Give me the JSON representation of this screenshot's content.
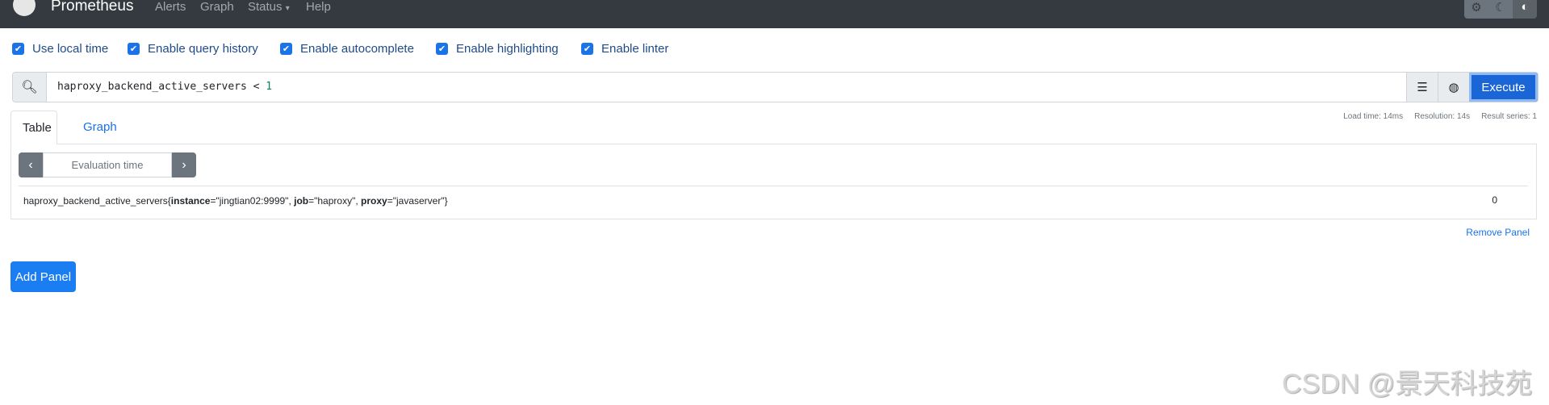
{
  "navbar": {
    "brand": "Prometheus",
    "links": [
      "Alerts",
      "Graph",
      "Status",
      "Help"
    ],
    "status_caret": "▾",
    "theme_icons": [
      "gear-icon",
      "moon-icon",
      "contrast-icon"
    ]
  },
  "options": [
    {
      "label": "Use local time",
      "checked": true
    },
    {
      "label": "Enable query history",
      "checked": true
    },
    {
      "label": "Enable autocomplete",
      "checked": true
    },
    {
      "label": "Enable highlighting",
      "checked": true
    },
    {
      "label": "Enable linter",
      "checked": true
    }
  ],
  "query": {
    "metric": "haproxy_backend_active_servers",
    "operator": "<",
    "value": "1",
    "execute_label": "Execute"
  },
  "stats": {
    "load_time": "Load time: 14ms",
    "resolution": "Resolution: 14s",
    "result_series": "Result series: 1"
  },
  "tabs": {
    "table": "Table",
    "graph": "Graph"
  },
  "eval": {
    "placeholder": "Evaluation time"
  },
  "result": {
    "metric": "haproxy_backend_active_servers",
    "labels": [
      {
        "k": "instance",
        "v": "\"jingtian02:9999\""
      },
      {
        "k": "job",
        "v": "\"haproxy\""
      },
      {
        "k": "proxy",
        "v": "\"javaserver\""
      }
    ],
    "value": "0"
  },
  "remove_panel": "Remove Panel",
  "add_panel": "Add Panel",
  "watermark": "CSDN @景天科技苑"
}
